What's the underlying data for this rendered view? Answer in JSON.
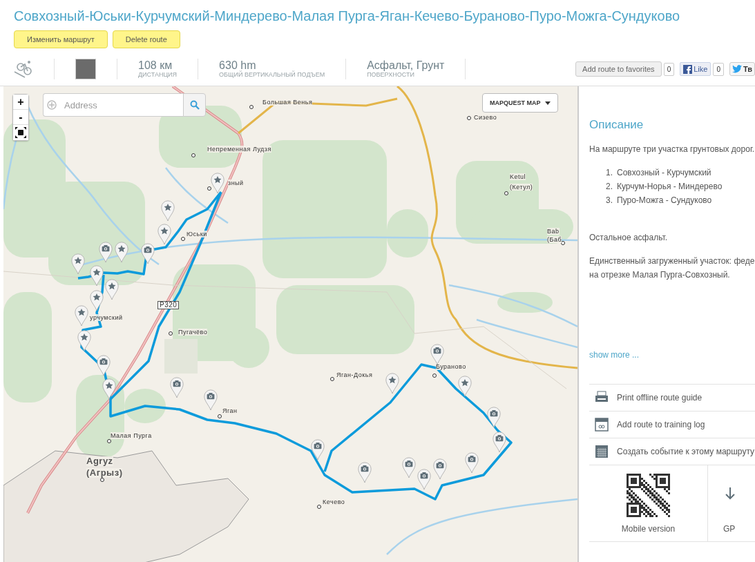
{
  "title": "Совхозный-Юськи-Курчумский-Миндерево-Малая Пурга-Яган-Кечево-Бураново-Пуро-Можга-Сундуково",
  "route_buttons": [
    {
      "label": "Изменить маршрут"
    },
    {
      "label": "Delete route"
    }
  ],
  "stats": [
    {
      "value": "108 км",
      "label": "ДИСТАНЦИЯ"
    },
    {
      "value": "630 hm",
      "label": "ОБЩИЙ ВЕРТИКАЛЬНЫЙ ПОДЪЕМ"
    },
    {
      "value": "Асфальт, Грунт",
      "label": "ПОВЕРХНОСТИ"
    }
  ],
  "social": {
    "favorites": {
      "label": "Add route to favorites",
      "count": "0"
    },
    "like": {
      "label": "Like",
      "count": "0"
    },
    "tweet": {
      "label": "Тв"
    }
  },
  "map": {
    "zoom_in": "+",
    "zoom_out": "-",
    "search": {
      "placeholder": "Address"
    },
    "layer_menu": "MAPQUEST MAP",
    "places": [
      {
        "name": "Большая Венья"
      },
      {
        "name": "Непременная Лудзя"
      },
      {
        "name": "зный"
      },
      {
        "name": "Юськи"
      },
      {
        "name": "урчумский"
      },
      {
        "name": "Пугачёво"
      },
      {
        "name": "Р320"
      },
      {
        "name": "Малая Пурга"
      },
      {
        "name": "Agryz"
      },
      {
        "name": "(Агрыз)"
      },
      {
        "name": "Кечево"
      },
      {
        "name": "Яган"
      },
      {
        "name": "Яган-Докья"
      },
      {
        "name": "Бураново"
      },
      {
        "name": "Сизево"
      },
      {
        "name": "Ketul"
      },
      {
        "name": "(Кетул)"
      },
      {
        "name": "Bab"
      },
      {
        "name": "(Баб"
      }
    ],
    "markers": [
      {
        "kind": "star"
      },
      {
        "kind": "star"
      },
      {
        "kind": "star"
      },
      {
        "kind": "star"
      },
      {
        "kind": "camera"
      },
      {
        "kind": "camera"
      },
      {
        "kind": "star"
      },
      {
        "kind": "star"
      },
      {
        "kind": "star"
      },
      {
        "kind": "star"
      },
      {
        "kind": "star"
      },
      {
        "kind": "star"
      },
      {
        "kind": "camera"
      },
      {
        "kind": "star"
      },
      {
        "kind": "camera"
      },
      {
        "kind": "camera"
      },
      {
        "kind": "camera"
      },
      {
        "kind": "camera"
      },
      {
        "kind": "camera"
      },
      {
        "kind": "camera"
      },
      {
        "kind": "camera"
      },
      {
        "kind": "camera"
      },
      {
        "kind": "camera"
      },
      {
        "kind": "camera"
      },
      {
        "kind": "star"
      },
      {
        "kind": "star"
      },
      {
        "kind": "camera"
      }
    ]
  },
  "sidebar": {
    "heading": "Описание",
    "intro": "На маршруте три участка грунтовых дорог.",
    "list": [
      {
        "number": "1.",
        "text": "Совхозный - Курчумский"
      },
      {
        "number": "2.",
        "text": "Курчум-Норья - Миндерево"
      },
      {
        "number": "3.",
        "text": "Пуро-Можга - Сундуково"
      }
    ],
    "paragraphs": [
      "Остальное асфальт.",
      "Единственный загруженный участок: феде на отрезке Малая Пурга-Совхозный."
    ],
    "show_more": "show more ...",
    "actions": [
      {
        "kind": "print",
        "label": "Print offline route guide"
      },
      {
        "kind": "log",
        "label": "Add route to training log"
      },
      {
        "kind": "event",
        "label": "Создать событие к этому маршруту"
      }
    ],
    "exports": [
      {
        "kind": "qr",
        "label": "Mobile version"
      },
      {
        "kind": "gps",
        "label": "GP"
      }
    ]
  }
}
